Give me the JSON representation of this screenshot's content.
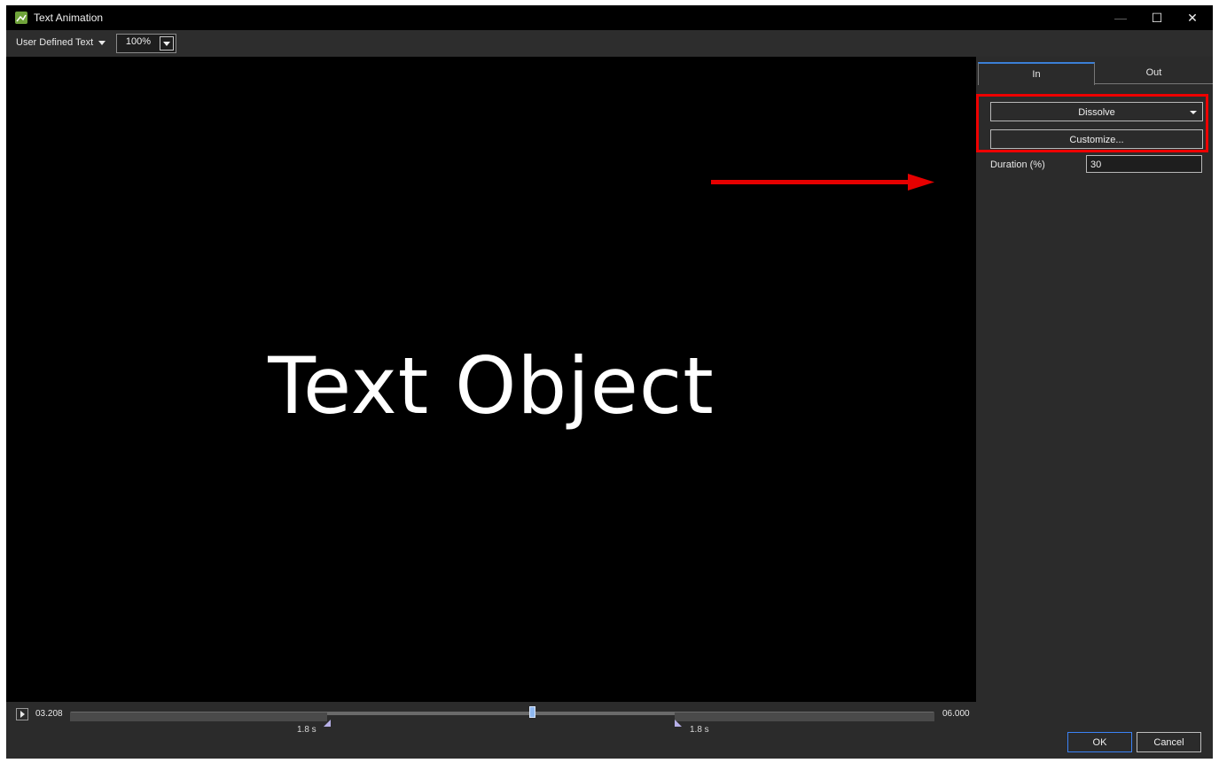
{
  "window": {
    "title": "Text Animation",
    "minimize_glyph": "—",
    "maximize_glyph": "☐",
    "close_glyph": "✕"
  },
  "toolbar": {
    "text_source": "User Defined Text",
    "zoom_value": "100%"
  },
  "preview": {
    "text": "Text Object"
  },
  "side_panel": {
    "tabs": [
      {
        "label": "In",
        "selected": true
      },
      {
        "label": "Out",
        "selected": false
      }
    ],
    "effect_select": "Dissolve",
    "customize_label": "Customize...",
    "duration_label": "Duration (%)",
    "duration_value": "30"
  },
  "timeline": {
    "current_time": "03.208",
    "end_time": "06.000",
    "in_duration": "1.8 s",
    "out_duration": "1.8 s",
    "playhead_fraction": 0.535
  },
  "dialog": {
    "ok_label": "OK",
    "cancel_label": "Cancel"
  },
  "annotation": {
    "arrow_color": "#e60000",
    "highlight_color": "#e60000"
  }
}
